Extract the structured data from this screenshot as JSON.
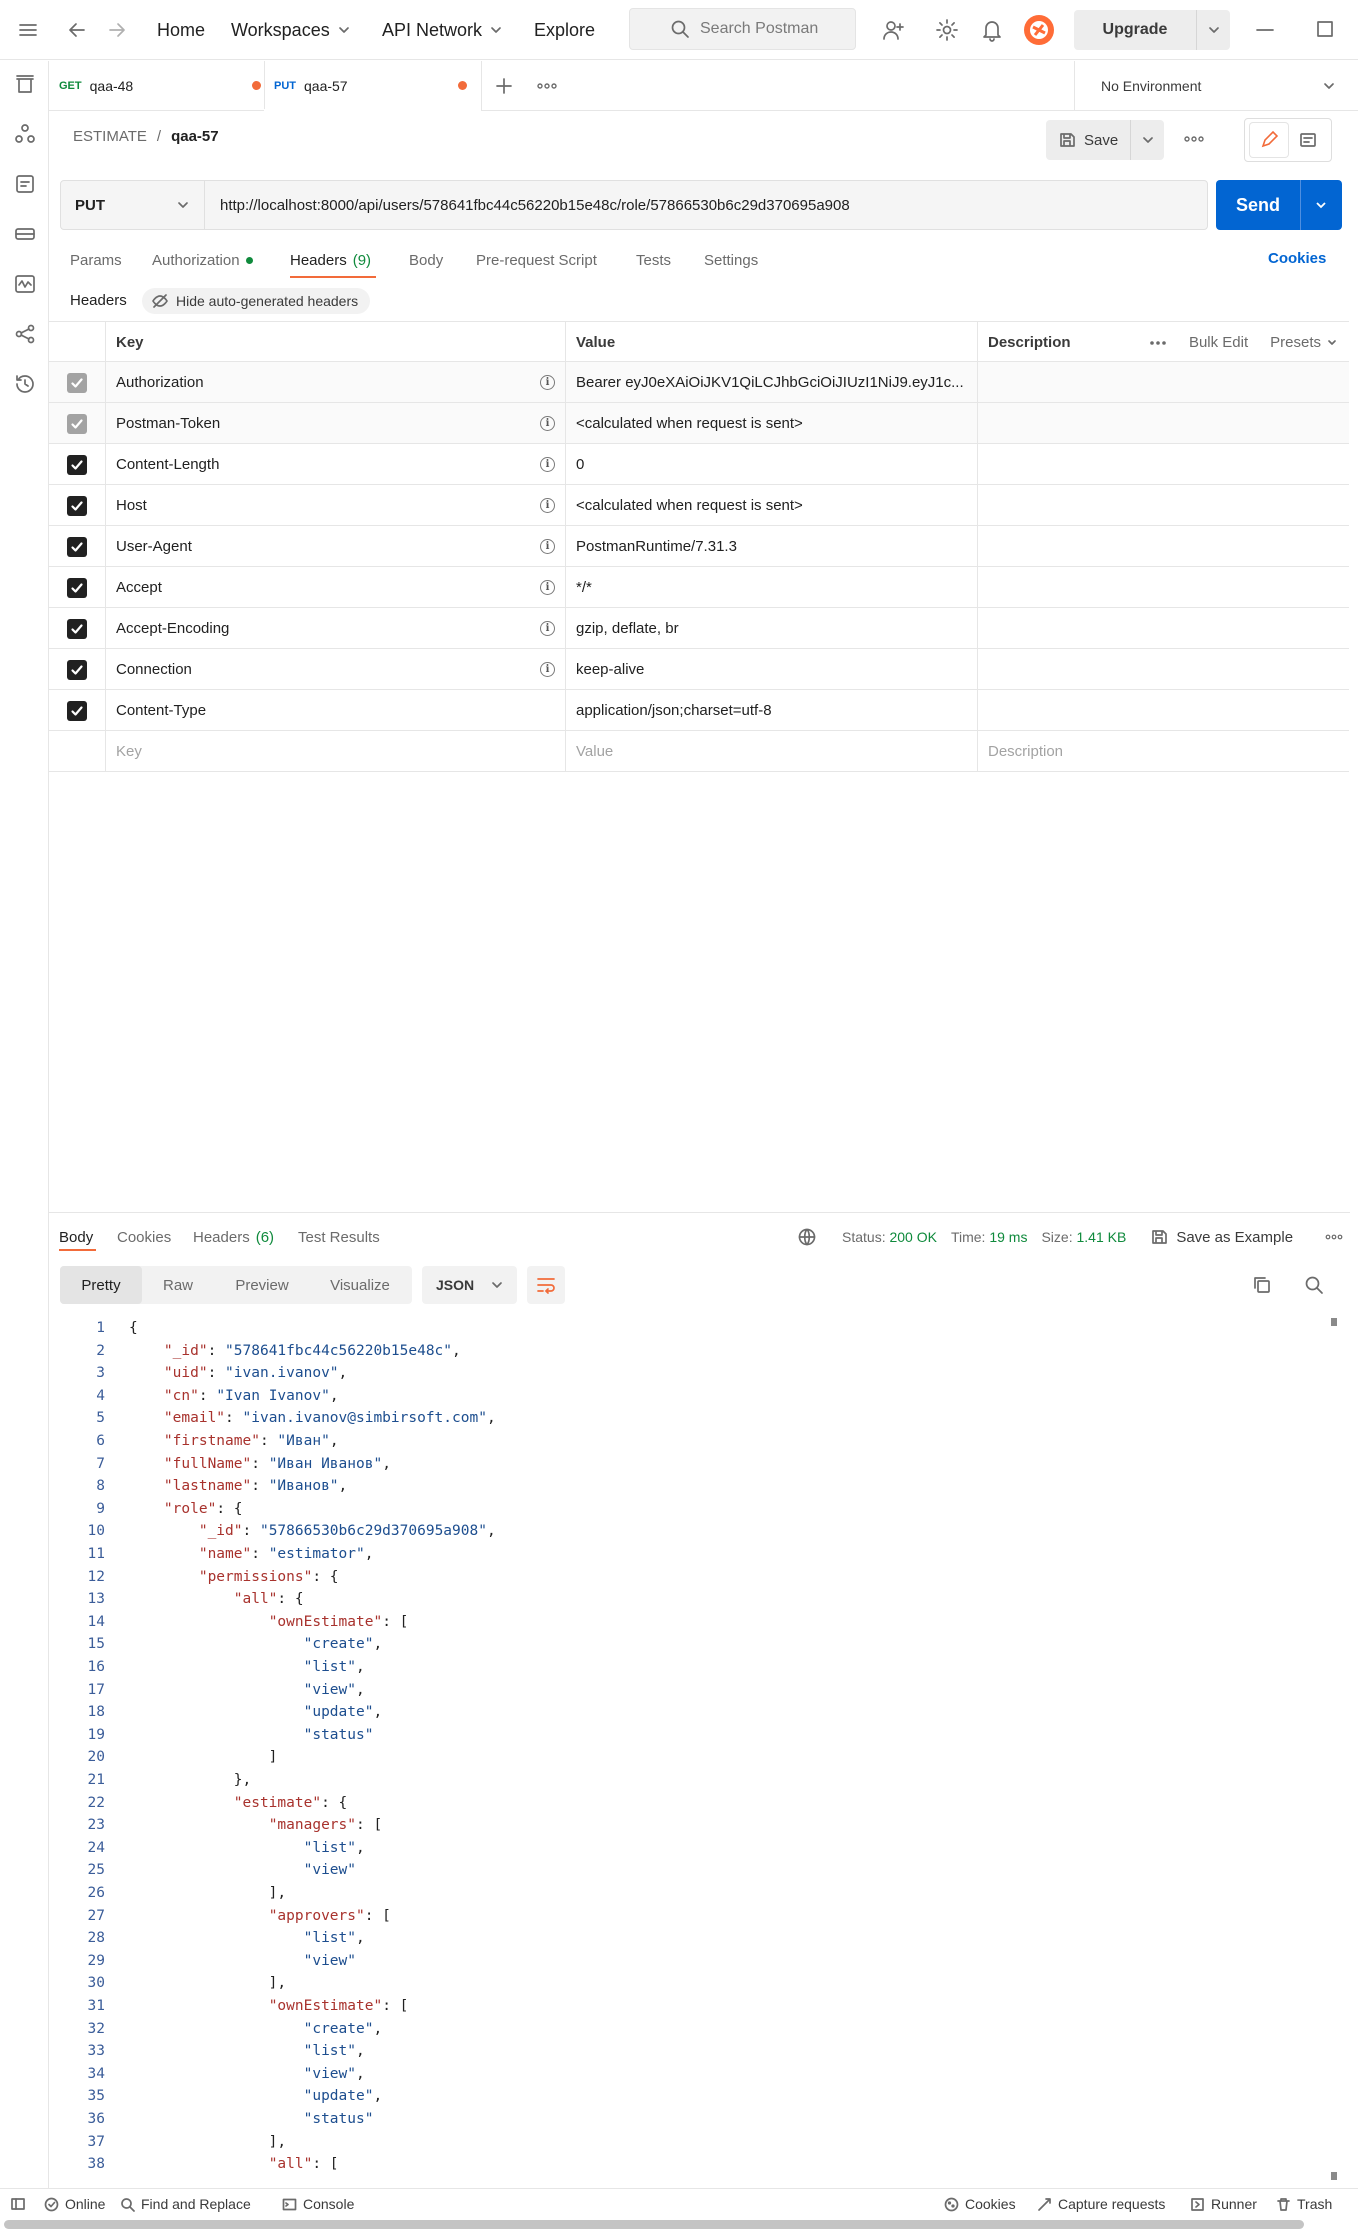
{
  "topbar": {
    "nav": [
      "Home",
      "Workspaces",
      "API Network",
      "Explore"
    ],
    "search_placeholder": "Search Postman",
    "upgrade_label": "Upgrade",
    "brand_color": "#ff6c37"
  },
  "tabs": [
    {
      "method": "GET",
      "name": "qaa-48",
      "method_color": "#0f8a3c",
      "unsaved": true
    },
    {
      "method": "PUT",
      "name": "qaa-57",
      "method_color": "#0265d2",
      "unsaved": true,
      "active": true
    }
  ],
  "environment": "No Environment",
  "breadcrumb": {
    "collection": "ESTIMATE",
    "separator": "/",
    "request": "qaa-57"
  },
  "save_label": "Save",
  "request": {
    "method": "PUT",
    "url": "http://localhost:8000/api/users/578641fbc44c56220b15e48c/role/57866530b6c29d370695a908",
    "send_label": "Send"
  },
  "req_tabs": {
    "params": "Params",
    "authorization": "Authorization",
    "headers": "Headers",
    "headers_count": "(9)",
    "body": "Body",
    "prerequest": "Pre-request Script",
    "tests": "Tests",
    "settings": "Settings",
    "cookies": "Cookies"
  },
  "headers_section": {
    "label": "Headers",
    "hide_auto": "Hide auto-generated headers"
  },
  "headers_table": {
    "columns": {
      "key": "Key",
      "value": "Value",
      "description": "Description"
    },
    "bulk_edit": "Bulk Edit",
    "presets": "Presets",
    "rows": [
      {
        "key": "Authorization",
        "value": "Bearer eyJ0eXAiOiJKV1QiLCJhbGciOiJIUzI1NiJ9.eyJ1c...",
        "auto": true,
        "info": true
      },
      {
        "key": "Postman-Token",
        "value": "<calculated when request is sent>",
        "auto": true,
        "info": true
      },
      {
        "key": "Content-Length",
        "value": "0",
        "auto": false,
        "info": true
      },
      {
        "key": "Host",
        "value": "<calculated when request is sent>",
        "auto": false,
        "info": true
      },
      {
        "key": "User-Agent",
        "value": "PostmanRuntime/7.31.3",
        "auto": false,
        "info": true
      },
      {
        "key": "Accept",
        "value": "*/*",
        "auto": false,
        "info": true
      },
      {
        "key": "Accept-Encoding",
        "value": "gzip, deflate, br",
        "auto": false,
        "info": true
      },
      {
        "key": "Connection",
        "value": "keep-alive",
        "auto": false,
        "info": true
      },
      {
        "key": "Content-Type",
        "value": "application/json;charset=utf-8",
        "auto": false,
        "info": false
      }
    ],
    "new_row": {
      "key": "Key",
      "value": "Value",
      "description": "Description"
    }
  },
  "response": {
    "tabs": {
      "body": "Body",
      "cookies": "Cookies",
      "headers": "Headers",
      "headers_count": "(6)",
      "tests": "Test Results"
    },
    "status_label": "Status:",
    "status": "200 OK",
    "time_label": "Time:",
    "time": "19 ms",
    "size_label": "Size:",
    "size": "1.41 KB",
    "save_example": "Save as Example",
    "views": [
      "Pretty",
      "Raw",
      "Preview",
      "Visualize"
    ],
    "format": "JSON",
    "code_lines": [
      "{",
      "    \"_id\": \"578641fbc44c56220b15e48c\",",
      "    \"uid\": \"ivan.ivanov\",",
      "    \"cn\": \"Ivan Ivanov\",",
      "    \"email\": \"ivan.ivanov@simbirsoft.com\",",
      "    \"firstname\": \"Иван\",",
      "    \"fullName\": \"Иван Иванов\",",
      "    \"lastname\": \"Иванов\",",
      "    \"role\": {",
      "        \"_id\": \"57866530b6c29d370695a908\",",
      "        \"name\": \"estimator\",",
      "        \"permissions\": {",
      "            \"all\": {",
      "                \"ownEstimate\": [",
      "                    \"create\",",
      "                    \"list\",",
      "                    \"view\",",
      "                    \"update\",",
      "                    \"status\"",
      "                ]",
      "            },",
      "            \"estimate\": {",
      "                \"managers\": [",
      "                    \"list\",",
      "                    \"view\"",
      "                ],",
      "                \"approvers\": [",
      "                    \"list\",",
      "                    \"view\"",
      "                ],",
      "                \"ownEstimate\": [",
      "                    \"create\",",
      "                    \"list\",",
      "                    \"view\",",
      "                    \"update\",",
      "                    \"status\"",
      "                ],",
      "                \"all\": ["
    ]
  },
  "footer": {
    "online": "Online",
    "find_replace": "Find and Replace",
    "console": "Console",
    "cookies": "Cookies",
    "capture": "Capture requests",
    "runner": "Runner",
    "trash": "Trash"
  }
}
